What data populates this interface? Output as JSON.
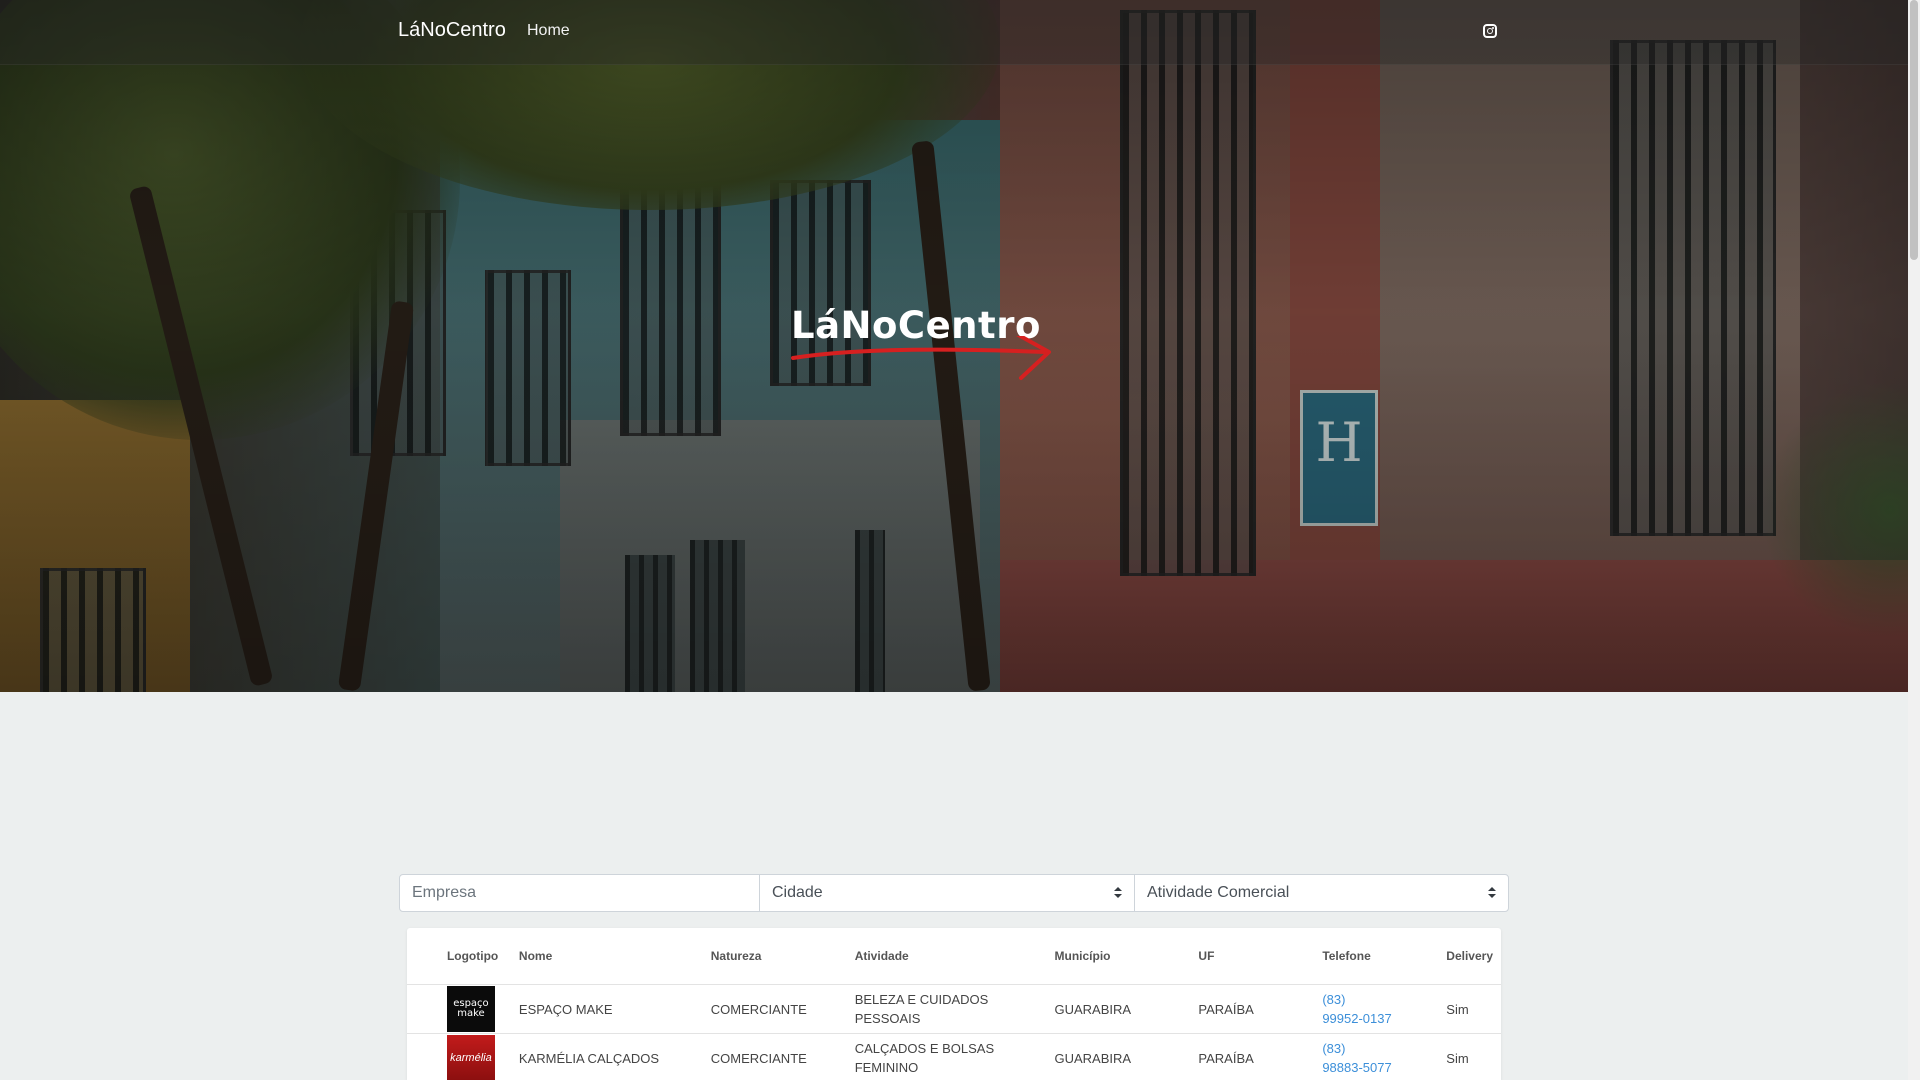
{
  "navbar": {
    "brand": "LáNoCentro",
    "home": "Home",
    "social_icon": "instagram-icon"
  },
  "hero": {
    "logo_text": "LáNoCentro",
    "accent_color": "#d62020"
  },
  "filters": {
    "company_placeholder": "Empresa",
    "city_label": "Cidade",
    "activity_label": "Atividade Comercial"
  },
  "table": {
    "headers": [
      "Logotipo",
      "Nome",
      "Natureza",
      "Atividade",
      "Município",
      "UF",
      "Telefone",
      "Delivery"
    ],
    "rows": [
      {
        "logo_text": "espaço make",
        "name": "ESPAÇO MAKE",
        "nature": "COMERCIANTE",
        "activity": "BELEZA E CUIDADOS PESSOAIS",
        "city": "GUARABIRA",
        "state": "PARAÍBA",
        "phone_area": "(83)",
        "phone_number": "99952-0137",
        "delivery": "Sim"
      },
      {
        "logo_text": "karmélia",
        "name": "KARMÉLIA CALÇADOS",
        "nature": "COMERCIANTE",
        "activity": "CALÇADOS E BOLSAS FEMININO",
        "city": "GUARABIRA",
        "state": "PARAÍBA",
        "phone_area": "(83)",
        "phone_number": "98883-5077",
        "delivery": "Sim"
      }
    ]
  }
}
